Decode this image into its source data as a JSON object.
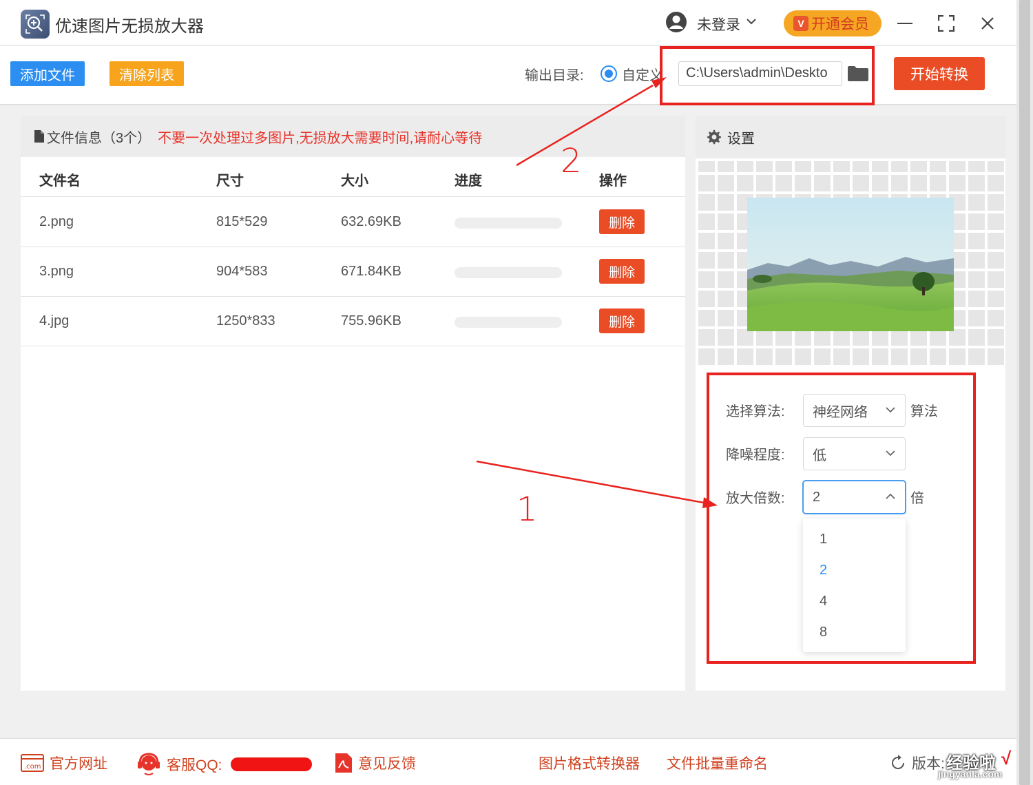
{
  "app": {
    "title": "优速图片无损放大器",
    "user_label": "未登录",
    "vip_label": "开通会员",
    "vip_badge": "V"
  },
  "toolbar": {
    "add_label": "添加文件",
    "clear_label": "清除列表",
    "output_label": "输出目录:",
    "custom_option": "自定义",
    "output_path": "C:\\Users\\admin\\Deskto",
    "start_label": "开始转换"
  },
  "file_panel": {
    "info_label": "文件信息",
    "info_count": "（3个）",
    "warning": "不要一次处理过多图片,无损放大需要时间,请耐心等待",
    "columns": [
      "文件名",
      "尺寸",
      "大小",
      "进度",
      "操作"
    ],
    "rows": [
      {
        "name": "2.png",
        "dimensions": "815*529",
        "size": "632.69KB",
        "progress": 0,
        "action": "删除"
      },
      {
        "name": "3.png",
        "dimensions": "904*583",
        "size": "671.84KB",
        "progress": 0,
        "action": "删除"
      },
      {
        "name": "4.jpg",
        "dimensions": "1250*833",
        "size": "755.96KB",
        "progress": 0,
        "action": "删除"
      }
    ]
  },
  "settings": {
    "title": "设置",
    "algorithm_label": "选择算法:",
    "algorithm_value": "神经网络",
    "algorithm_unit": "算法",
    "denoise_label": "降噪程度:",
    "denoise_value": "低",
    "scale_label": "放大倍数:",
    "scale_value": "2",
    "scale_unit": "倍",
    "scale_options": [
      "1",
      "2",
      "4",
      "8"
    ],
    "scale_selected": "2"
  },
  "statusbar": {
    "website": "官方网址",
    "support_qq": "客服QQ:",
    "feedback": "意见反馈",
    "format_converter": "图片格式转换器",
    "batch_rename": "文件批量重命名",
    "version_label": "版本:"
  },
  "annotations": {
    "label_1": "1",
    "label_2": "2",
    "highlight_color": "#e8221e"
  },
  "watermark": {
    "text": "经验啦",
    "check": "√",
    "site": "jingyanla.com"
  },
  "colors": {
    "primary_blue": "#2b8ef0",
    "orange": "#f7a31b",
    "red_button": "#ea4d26"
  }
}
